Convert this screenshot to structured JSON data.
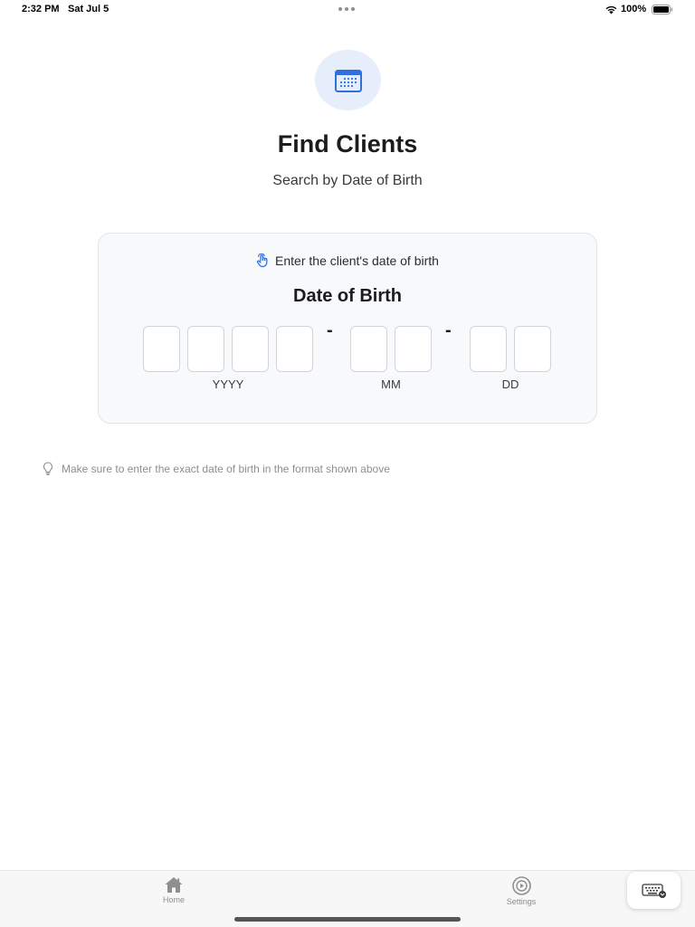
{
  "status_bar": {
    "time": "2:32 PM",
    "date": "Sat Jul 5",
    "battery": "100%"
  },
  "header": {
    "icon": "calendar-icon",
    "title": "Find Clients",
    "subtitle": "Search by Date of Birth"
  },
  "card": {
    "hint_icon": "tap-hand-icon",
    "hint": "Enter the client's date of birth",
    "title": "Date of Birth",
    "separator": "-",
    "groups": [
      {
        "label": "YYYY",
        "digits": [
          "",
          "",
          "",
          ""
        ]
      },
      {
        "label": "MM",
        "digits": [
          "",
          ""
        ]
      },
      {
        "label": "DD",
        "digits": [
          "",
          ""
        ]
      }
    ]
  },
  "tip": {
    "icon": "lightbulb-icon",
    "text": "Make sure to enter the exact date of birth in the format shown above"
  },
  "tab_bar": {
    "tabs": [
      {
        "label": "Home",
        "icon": "house-icon"
      },
      {
        "label": "Settings",
        "icon": "settings-circle-icon"
      }
    ],
    "keyboard_icon": "keyboard-dismiss-icon"
  },
  "colors": {
    "accent": "#2f6fde",
    "icon_circle_bg": "#e6eefc",
    "card_bg": "#f7f9fb",
    "card_border": "#e1e4e8"
  }
}
